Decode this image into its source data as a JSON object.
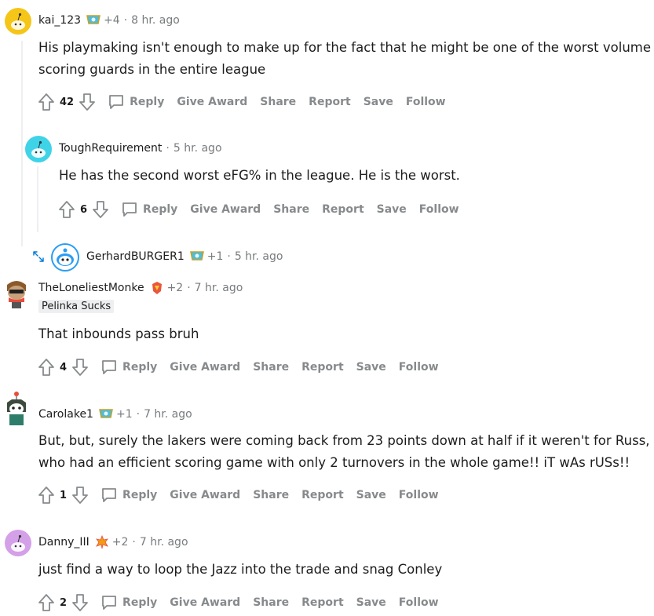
{
  "actions": {
    "reply": "Reply",
    "give_award": "Give Award",
    "share": "Share",
    "report": "Report",
    "save": "Save",
    "follow": "Follow"
  },
  "comments": [
    {
      "username": "kai_123",
      "award_count": "+4",
      "time": "8 hr. ago",
      "text": "His playmaking isn't enough to make up for the fact that he might be one of the worst volume scoring guards in the entire league",
      "score": "42",
      "avatar_color": "#f5c518"
    },
    {
      "username": "ToughRequirement",
      "time": "5 hr. ago",
      "text": "He has the second worst eFG% in the league. He is the worst.",
      "score": "6",
      "avatar_color": "#3fd3e8"
    },
    {
      "username": "GerhardBURGER1",
      "award_count": "+1",
      "time": "5 hr. ago",
      "avatar_color": "#2a9df4"
    },
    {
      "username": "TheLoneliestMonke",
      "award_count": "+2",
      "time": "7 hr. ago",
      "flair": "Pelinka Sucks",
      "text": "That inbounds pass bruh",
      "score": "4"
    },
    {
      "username": "Carolake1",
      "award_count": "+1",
      "time": "7 hr. ago",
      "text": "But, but, surely the lakers were coming back from 23 points down at half if it weren't for Russ, who had an efficient scoring game with only 2 turnovers in the whole game!! iT wAs rUSs!!",
      "score": "1"
    },
    {
      "username": "Danny_III",
      "award_count": "+2",
      "time": "7 hr. ago",
      "text": "just find a way to loop the Jazz into the trade and snag Conley",
      "score": "2",
      "avatar_color": "#d4a0e8"
    }
  ]
}
